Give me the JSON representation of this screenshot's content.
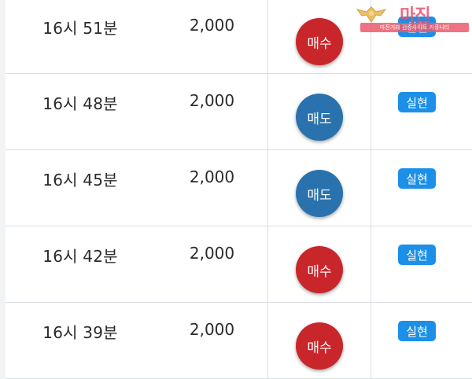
{
  "rows": [
    {
      "time": "16시 51분",
      "amount": "2,000",
      "side": "매수",
      "side_type": "buy",
      "status": "실현"
    },
    {
      "time": "16시 48분",
      "amount": "2,000",
      "side": "매도",
      "side_type": "sell",
      "status": "실현"
    },
    {
      "time": "16시 45분",
      "amount": "2,000",
      "side": "매도",
      "side_type": "sell",
      "status": "실현"
    },
    {
      "time": "16시 42분",
      "amount": "2,000",
      "side": "매수",
      "side_type": "buy",
      "status": "실현"
    },
    {
      "time": "16시 39분",
      "amount": "2,000",
      "side": "매수",
      "side_type": "buy",
      "status": "실현"
    }
  ],
  "watermark": {
    "title": "마진",
    "subtitle": "마진거래 검증사이트 커뮤니티"
  },
  "colors": {
    "buy": "#c9262b",
    "sell": "#2a72ad",
    "status": "#1c8fe8"
  }
}
